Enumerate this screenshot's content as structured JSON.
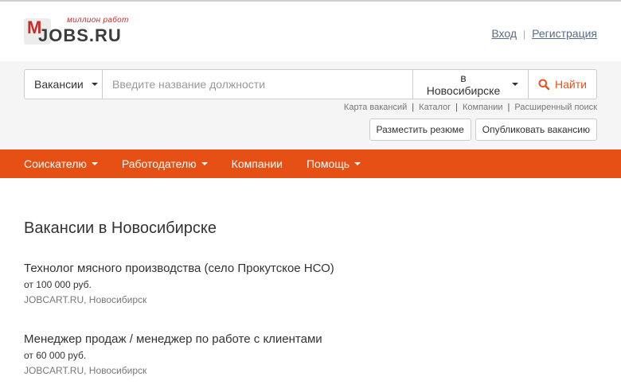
{
  "header": {
    "logo_tagline": "миллион работ",
    "logo_brand": "JOBS.RU",
    "logo_letter": "M",
    "login": "Вход",
    "register": "Регистрация"
  },
  "search": {
    "type_select": "Вакансии",
    "placeholder": "Введите название должности",
    "city_select": "в Новосибирске",
    "find_label": "Найти"
  },
  "sublinks": [
    "Карта вакансий",
    "Каталог",
    "Компании",
    "Расширенный поиск"
  ],
  "actions": {
    "post_resume": "Разместить резюме",
    "post_vacancy": "Опубликовать вакансию"
  },
  "nav": [
    "Соискателю",
    "Работодателю",
    "Компании",
    "Помощь"
  ],
  "page_title": "Вакансии в Новосибирске",
  "vacancies": [
    {
      "title": "Технолог мясного производства (село Прокутское НСО)",
      "salary": "от 100 000 руб.",
      "source": "JOBCART.RU, Новосибирск"
    },
    {
      "title": "Менеджер продаж / менеджер по работе с клиентами",
      "salary": "от 60 000 руб.",
      "source": "JOBCART.RU, Новосибирск"
    }
  ],
  "colors": {
    "accent": "#e65014",
    "logo_red": "#c62b27"
  }
}
